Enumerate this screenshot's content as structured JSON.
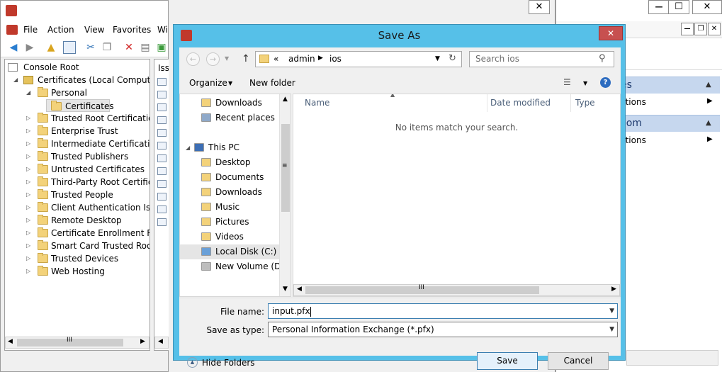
{
  "mmc": {
    "menu": [
      "File",
      "Action",
      "View",
      "Favorites",
      "Wi"
    ],
    "tree": {
      "root": "Console Root",
      "store": "Certificates (Local Computer)",
      "personal": "Personal",
      "certificates": "Certificates",
      "folders": [
        "Trusted Root Certification",
        "Enterprise Trust",
        "Intermediate Certification",
        "Trusted Publishers",
        "Untrusted Certificates",
        "Third-Party Root Certificat",
        "Trusted People",
        "Client Authentication Issue",
        "Remote Desktop",
        "Certificate Enrollment Requ",
        "Smart Card Trusted Roots",
        "Trusted Devices",
        "Web Hosting"
      ]
    },
    "mid_header": "Issu",
    "scroll_glyph": "III"
  },
  "actions": {
    "header1": "es",
    "item1": "ctions",
    "header2": "com",
    "item2": "ctions"
  },
  "window_controls": {
    "close": "✕",
    "minimize": "—",
    "maximize": "☐",
    "restore": "❐"
  },
  "dialog": {
    "title": "Save As",
    "close_glyph": "✕",
    "address": {
      "prefix": "«",
      "parts": [
        "admin",
        "ios"
      ]
    },
    "search_placeholder": "Search ios",
    "organize": "Organize",
    "new_folder": "New folder",
    "help": "?",
    "nav_items": [
      {
        "label": "Downloads"
      },
      {
        "label": "Recent places"
      },
      {
        "label": "This PC"
      },
      {
        "label": "Desktop"
      },
      {
        "label": "Documents"
      },
      {
        "label": "Downloads"
      },
      {
        "label": "Music"
      },
      {
        "label": "Pictures"
      },
      {
        "label": "Videos"
      },
      {
        "label": "Local Disk (C:)"
      },
      {
        "label": "New Volume (D:)"
      }
    ],
    "columns": [
      "Name",
      "Date modified",
      "Type"
    ],
    "empty_message": "No items match your search.",
    "file_name_label": "File name:",
    "file_name_value": "input.pfx",
    "save_type_label": "Save as type:",
    "save_type_value": "Personal Information Exchange (*.pfx)",
    "hide_folders": "Hide Folders",
    "save_button": "Save",
    "cancel_button": "Cancel"
  },
  "colors": {
    "dialog_frame": "#56c0e8",
    "close_button": "#c75050",
    "folder": "#f3d27a",
    "action_header": "#c6d7ee",
    "selection": "#cce8ff"
  }
}
